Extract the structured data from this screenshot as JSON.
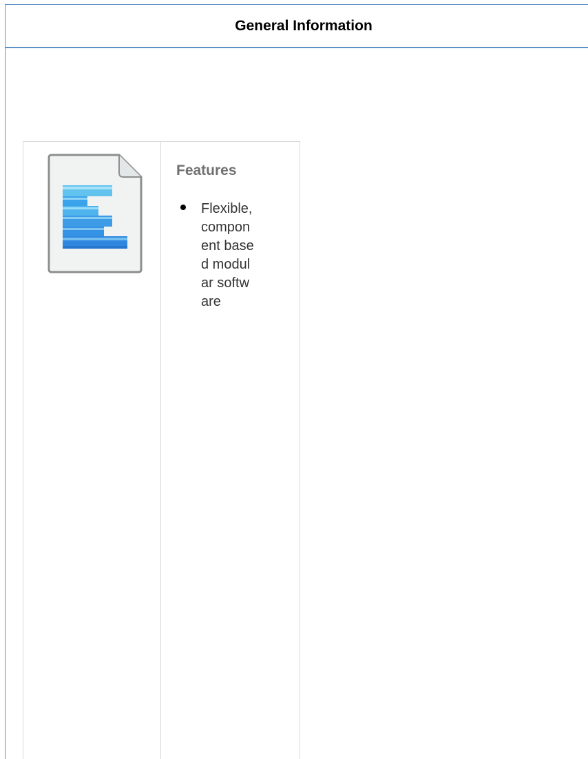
{
  "panel": {
    "title": "General Information"
  },
  "features": {
    "heading": "Features",
    "items": [
      "Flexible, component based modular software"
    ]
  },
  "icons": {
    "document": "document-icon"
  },
  "colors": {
    "panel_border": "#5a8fc8",
    "table_border": "#d9d9d9",
    "heading_gray": "#707070",
    "icon_blue": "#3d9be8",
    "icon_light_blue": "#8fd4f5"
  }
}
